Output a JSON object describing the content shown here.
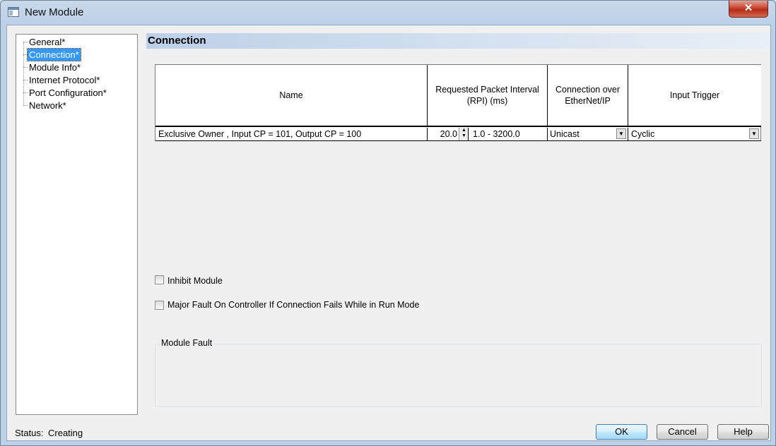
{
  "window": {
    "title": "New Module",
    "close_label": "✕"
  },
  "nav": {
    "items": [
      {
        "label": "General*"
      },
      {
        "label": "Connection*"
      },
      {
        "label": "Module Info*"
      },
      {
        "label": "Internet Protocol*"
      },
      {
        "label": "Port Configuration*"
      },
      {
        "label": "Network*"
      }
    ],
    "selected": "Connection*"
  },
  "section": {
    "title": "Connection"
  },
  "grid": {
    "headers": {
      "name": "Name",
      "rpi": "Requested Packet Interval (RPI) (ms)",
      "connection_over": "Connection over EtherNet/IP",
      "input_trigger": "Input Trigger"
    },
    "row": {
      "name": "Exclusive Owner , Input  CP = 101, Output  CP = 100",
      "rpi_value": "20.0",
      "rpi_range": "1.0 - 3200.0",
      "connection_type": "Unicast",
      "input_trigger": "Cyclic"
    }
  },
  "options": {
    "inhibit_label": "Inhibit Module",
    "major_fault_label": "Major Fault On Controller If Connection Fails While in Run Mode"
  },
  "fault": {
    "title": "Module Fault"
  },
  "status": {
    "label": "Status:",
    "value": "Creating"
  },
  "buttons": {
    "ok": "OK",
    "cancel": "Cancel",
    "help": "Help"
  },
  "icons": {
    "app": "window-icon",
    "close": "close-icon",
    "dropdown": "chevron-down-icon",
    "spinner": "spinner-icon"
  },
  "colors": {
    "selection": "#3399ff",
    "titlebar": "#bcd0e8",
    "close": "#c74530"
  }
}
